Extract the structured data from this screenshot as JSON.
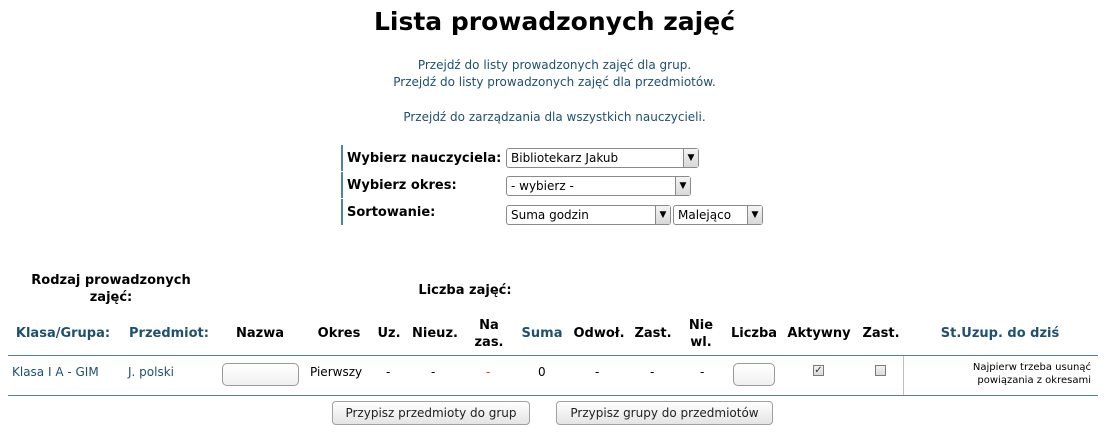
{
  "page": {
    "title": "Lista prowadzonych zajęć"
  },
  "nav": {
    "groups_link": "Przejdź do listy prowadzonych zajęć dla grup.",
    "subjects_link": "Przejdź do listy prowadzonych zajęć dla przedmiotów.",
    "all_teachers_link": "Przejdź do zarządzania dla wszystkich nauczycieli."
  },
  "filters": {
    "teacher_label": "Wybierz nauczyciela:",
    "teacher_value": "Bibliotekarz Jakub",
    "period_label": "Wybierz okres:",
    "period_value": "- wybierz -",
    "sort_label": "Sortowanie:",
    "sort_value": "Suma godzin",
    "sort_order_value": "Malejąco"
  },
  "table": {
    "group_heading": "Rodzaj prowadzonych zajęć:",
    "count_heading": "Liczba zajęć:",
    "columns": {
      "klasa": "Klasa/Grupa:",
      "przedmiot": "Przedmiot:",
      "nazwa": "Nazwa",
      "okres": "Okres",
      "uz": "Uz.",
      "nieuz": "Nieuz.",
      "nazas": "Na zas.",
      "suma": "Suma",
      "odwol": "Odwoł.",
      "zast": "Zast.",
      "niewl": "Nie wl.",
      "liczba": "Liczba",
      "aktywny": "Aktywny",
      "zast2": "Zast.",
      "stuzup": "St.Uzup. do dziś"
    },
    "rows": [
      {
        "klasa": "Klasa I A - GIM",
        "przedmiot": "J. polski",
        "nazwa": "",
        "okres": "Pierwszy",
        "uz": "-",
        "nieuz": "-",
        "nazas": "-",
        "suma": "0",
        "odwol": "-",
        "zast": "-",
        "niewl": "-",
        "liczba": "",
        "aktywny": true,
        "zast2": false,
        "note": "Najpierw trzeba usunąć powiązania z okresami"
      }
    ]
  },
  "buttons": {
    "assign_subjects": "Przypisz przedmioty do grup",
    "assign_groups": "Przypisz grupy do przedmiotów"
  },
  "colors": {
    "link": "#205070",
    "accent_line": "#4a86a4",
    "na_zas_dash": "#d04020"
  }
}
